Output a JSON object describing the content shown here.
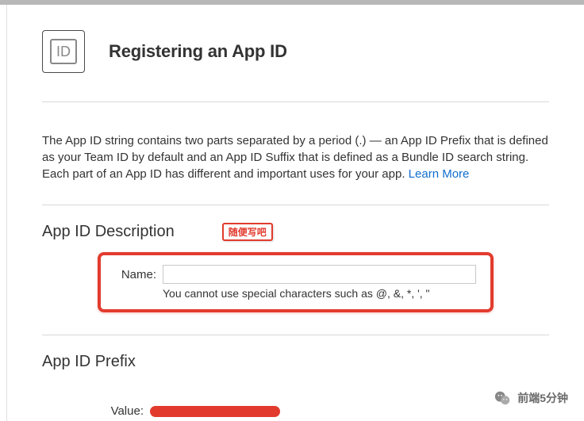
{
  "header": {
    "title": "Registering an App ID",
    "badge_text": "ID"
  },
  "intro": {
    "text": "The App ID string contains two parts separated by a period (.) — an App ID Prefix that is defined as your Team ID by default and an App ID Suffix that is defined as a Bundle ID search string. Each part of an App ID has different and important uses for your app. ",
    "link": "Learn More"
  },
  "section_desc": {
    "title": "App ID Description",
    "annotation": "随便写吧",
    "name_label": "Name:",
    "hint": "You cannot use special characters such as @, &, *, ', \""
  },
  "section_prefix": {
    "title": "App ID Prefix",
    "value_label": "Value:"
  },
  "watermark": {
    "text": "前端5分钟"
  }
}
